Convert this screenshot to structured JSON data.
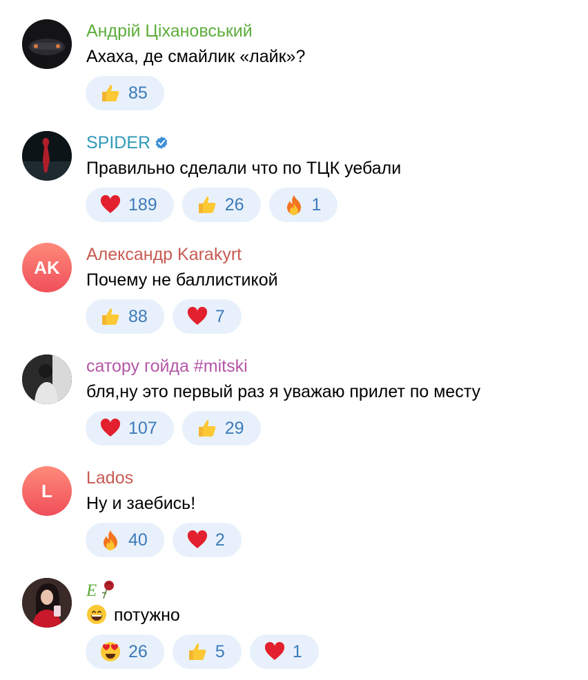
{
  "comments": [
    {
      "author": "Андрій Ціхановський",
      "author_color": "#5cad3b",
      "text": "Ахаха, де смайлик «лайк»?",
      "reactions": [
        {
          "emoji": "thumbs-up",
          "count": "85"
        }
      ]
    },
    {
      "author": "SPIDER",
      "author_color": "#2f9ab8",
      "verified": true,
      "text": "Правильно сделали что по ТЦК уебали",
      "reactions": [
        {
          "emoji": "heart",
          "count": "189"
        },
        {
          "emoji": "thumbs-up",
          "count": "26"
        },
        {
          "emoji": "fire",
          "count": "1"
        }
      ]
    },
    {
      "author": "Александр Karakyrt",
      "author_color": "#c85a52",
      "avatar_initials": "AK",
      "text": "Почему не баллистикой",
      "reactions": [
        {
          "emoji": "thumbs-up",
          "count": "88"
        },
        {
          "emoji": "heart",
          "count": "7"
        }
      ]
    },
    {
      "author": "сатору гойда #mitski",
      "author_color": "#b456a6",
      "text": "бля,ну это первый раз я уважаю прилет по месту",
      "reactions": [
        {
          "emoji": "heart",
          "count": "107"
        },
        {
          "emoji": "thumbs-up",
          "count": "29"
        }
      ]
    },
    {
      "author": "Lados",
      "author_color": "#c85a52",
      "avatar_initials": "L",
      "text": "Ну и заебись!",
      "reactions": [
        {
          "emoji": "fire",
          "count": "40"
        },
        {
          "emoji": "heart",
          "count": "2"
        }
      ]
    },
    {
      "author": "E",
      "author_color": "#5cad3b",
      "text": "потужно",
      "text_emoji": "grinning-face",
      "reactions": [
        {
          "emoji": "heart-eyes",
          "count": "26"
        },
        {
          "emoji": "thumbs-up",
          "count": "5"
        },
        {
          "emoji": "heart",
          "count": "1"
        }
      ]
    }
  ]
}
